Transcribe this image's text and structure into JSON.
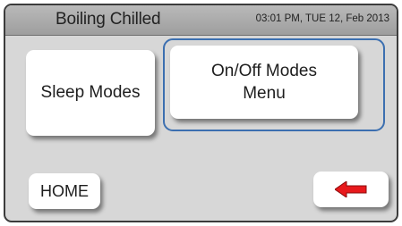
{
  "header": {
    "title": "Boiling Chilled",
    "datetime": "03:01 PM, TUE 12, Feb 2013"
  },
  "buttons": {
    "sleep_modes": "Sleep Modes",
    "onoff_line1": "On/Off Modes",
    "onoff_line2": "Menu",
    "home": "HOME"
  },
  "icons": {
    "back": "left-arrow-icon"
  },
  "colors": {
    "header": "#a8a8a8",
    "background": "#d7d7d7",
    "focus_ring": "#3c6fb0",
    "arrow": "#e8191c"
  }
}
